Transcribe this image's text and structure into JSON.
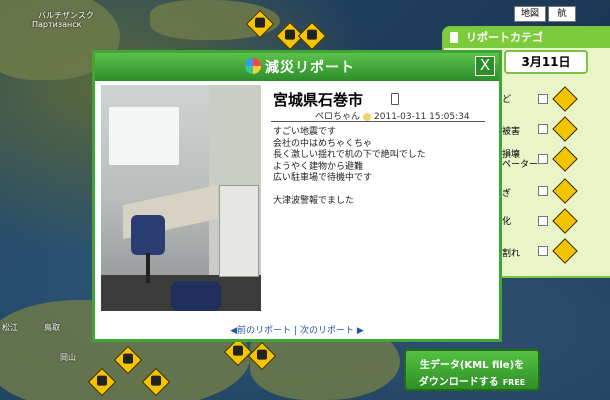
{
  "map": {
    "labels": [
      "バルチザンスク",
      "Партизанск",
      "鳥取",
      "岡山",
      "松江"
    ],
    "map_buttons": [
      "地図",
      "航"
    ]
  },
  "side_panel": {
    "header": "リポートカテゴ",
    "date": "3月11日",
    "categories": [
      "ど",
      "被害",
      "損壊\nペーター",
      "ぎ",
      "化",
      "割れ"
    ]
  },
  "dialog": {
    "title": "減災リポート",
    "location": "宮城県石巻市",
    "author": "ペロちゃん",
    "timestamp": "2011-03-11 15:05:34",
    "body_lines": [
      "すごい地震です",
      "会社の中はめちゃくちゃ",
      "長く激しい揺れで机の下で絶叫でした",
      "ようやく建物から避難",
      "広い駐車場で待機中です",
      "",
      "大津波警報でました"
    ],
    "prev_label": "◀前のリポート",
    "divider": "|",
    "next_label": "次のリポート ▶",
    "close_label": "X"
  },
  "download": {
    "line1": "生データ(KML file)を",
    "line2": "ダウンロードする",
    "free": "FREE"
  },
  "colors": {
    "accent_green": "#3fa534",
    "sign_yellow": "#f3c400",
    "link_blue": "#2255aa"
  }
}
